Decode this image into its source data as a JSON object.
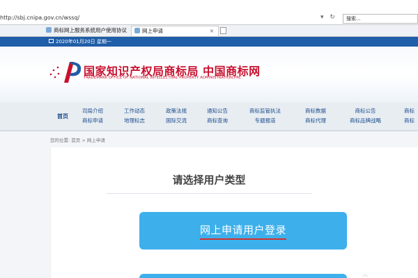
{
  "browser": {
    "url": "http://sbj.cnipa.gov.cn/wssq/",
    "search_placeholder": "搜索...",
    "tabs": [
      {
        "label": "商标网上服务系统用户使用协议"
      },
      {
        "label": "网上申请",
        "close": "×"
      }
    ]
  },
  "site": {
    "date": "2020年01月20日 星期一",
    "title": "国家知识产权局商标局 中国商标网",
    "subtitle": "TRADEMARK OFFICE OF NATIONAL INTELLECTUAL PROPERTY ADMINISTRATION,PRC"
  },
  "nav": {
    "home": "首页",
    "columns": [
      [
        "司局介绍",
        "商标申请"
      ],
      [
        "工作动态",
        "地理标志"
      ],
      [
        "政策法规",
        "国际交流"
      ],
      [
        "通知公告",
        "商标查询"
      ],
      [
        "商标监管执法",
        "专题报道"
      ],
      [
        "商标数据",
        "商标代理"
      ],
      [
        "商标公告",
        "商标品牌战略"
      ],
      [
        "商标",
        "商标"
      ]
    ]
  },
  "breadcrumb": "您的位置: 首页 > 网上申请",
  "main": {
    "heading": "请选择用户类型",
    "login_button": "网上申请用户登录"
  },
  "colors": {
    "brand_red": "#c8102e",
    "strip_blue": "#1f5ea8",
    "button_blue": "#3db0ec"
  }
}
